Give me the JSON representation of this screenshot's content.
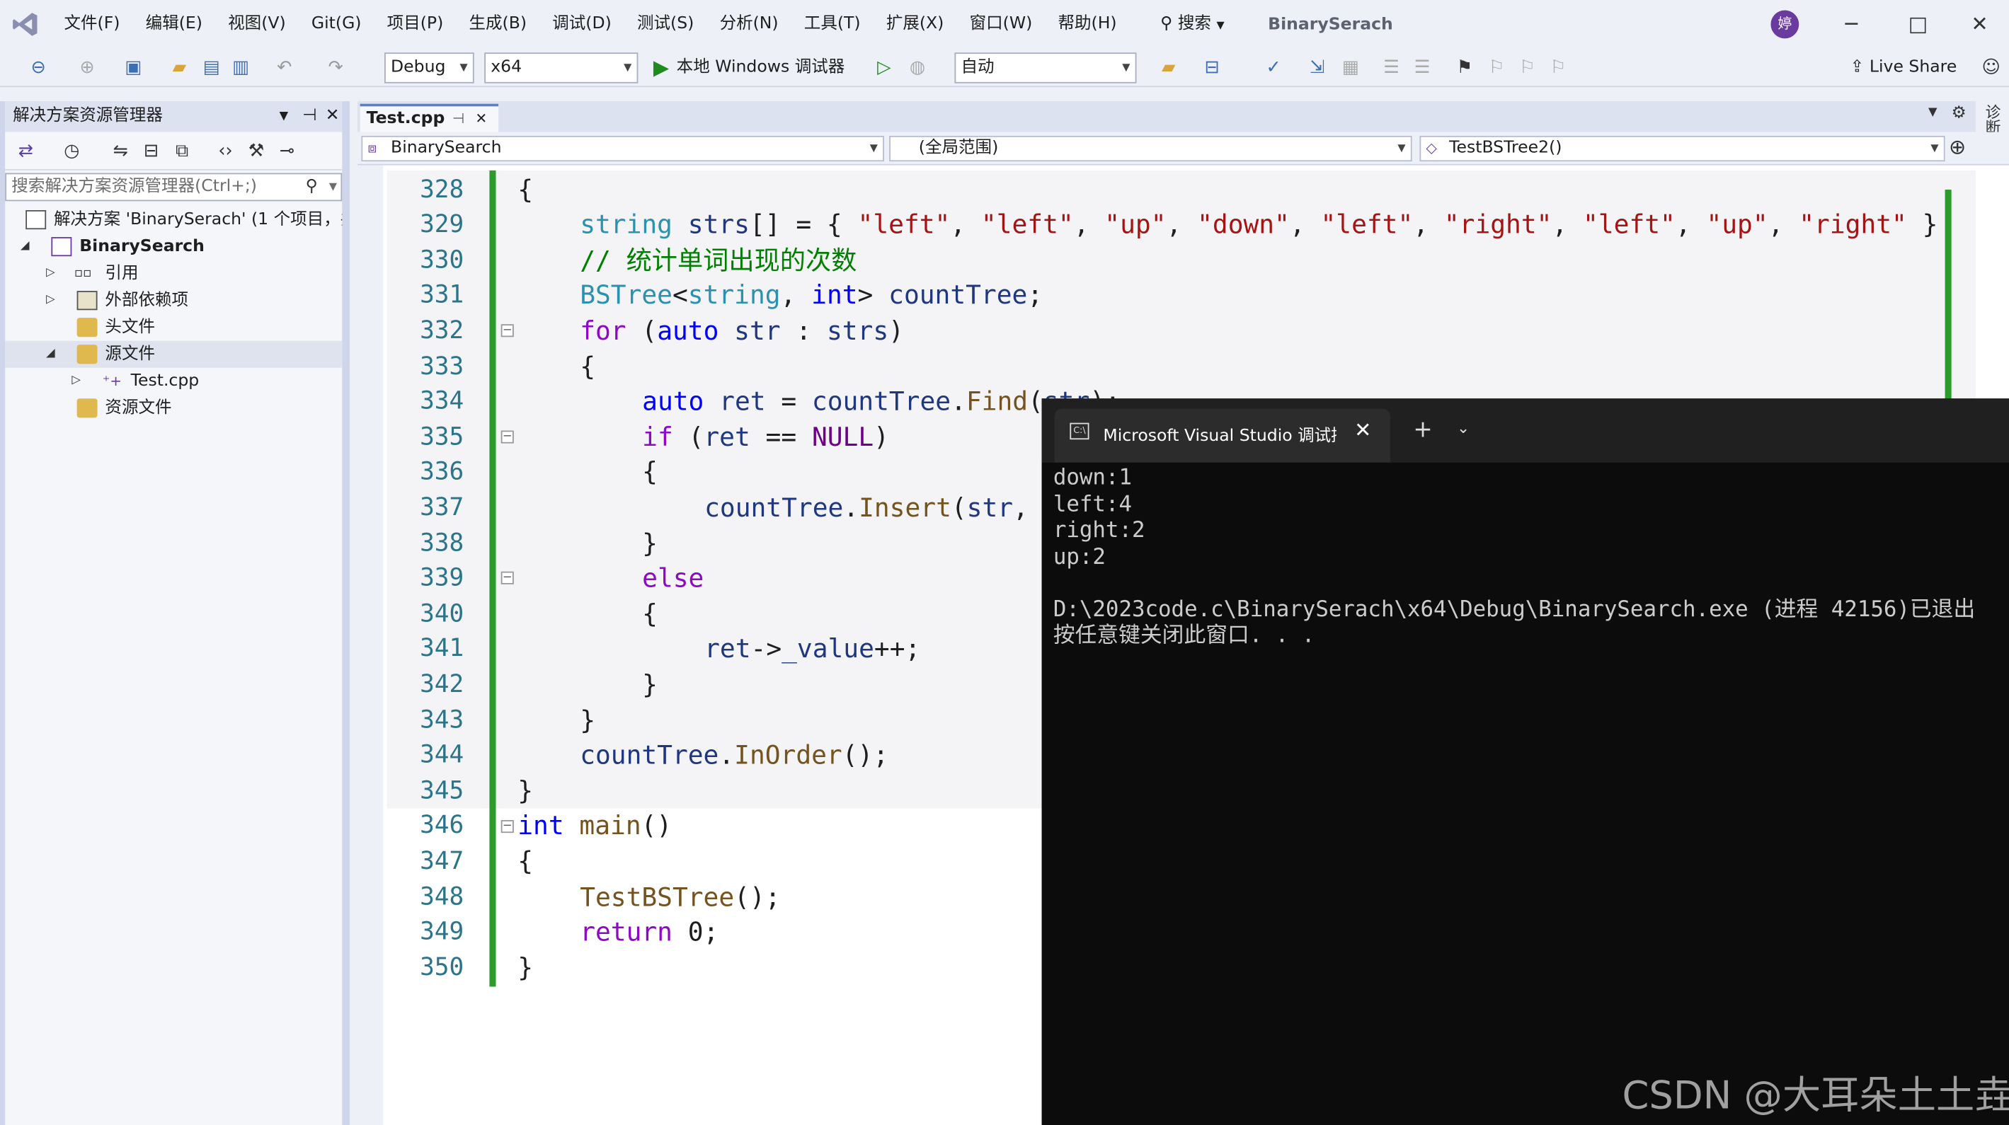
{
  "menubar": {
    "items": [
      "文件(F)",
      "编辑(E)",
      "视图(V)",
      "Git(G)",
      "项目(P)",
      "生成(B)",
      "调试(D)",
      "测试(S)",
      "分析(N)",
      "工具(T)",
      "扩展(X)",
      "窗口(W)",
      "帮助(H)"
    ],
    "search_label": "搜索",
    "solution_name": "BinarySerach",
    "avatar_text": "婷",
    "minimize": "─",
    "maximize": "□",
    "close": "✕"
  },
  "toolbar": {
    "config": "Debug",
    "platform": "x64",
    "run_label": "本地 Windows 调试器",
    "auto_combo": "自动",
    "live_share": "Live Share"
  },
  "solution_explorer": {
    "title": "解决方案资源管理器",
    "search_placeholder": "搜索解决方案资源管理器(Ctrl+;)",
    "solution_label": "解决方案 'BinarySerach' (1 个项目，共",
    "project": "BinarySearch",
    "items": [
      "引用",
      "外部依赖项",
      "头文件",
      "源文件",
      "Test.cpp",
      "资源文件"
    ]
  },
  "editor": {
    "tab_label": "Test.cpp",
    "tab_pin": "⊣",
    "tab_close": "✕",
    "nav_project": "BinarySearch",
    "nav_scope": "(全局范围)",
    "nav_function": "TestBSTree2()",
    "line_numbers": [
      "328",
      "329",
      "330",
      "331",
      "332",
      "333",
      "334",
      "335",
      "336",
      "337",
      "338",
      "339",
      "340",
      "341",
      "342",
      "343",
      "344",
      "345",
      "346",
      "347",
      "348",
      "349",
      "350"
    ]
  },
  "terminal": {
    "title": "Microsoft Visual Studio 调试控制台",
    "close": "✕",
    "new_tab": "+",
    "dropdown": "⌄",
    "lines": [
      "down:1",
      "left:4",
      "right:2",
      "up:2",
      "",
      "D:\\2023code.c\\BinarySerach\\x64\\Debug\\BinarySearch.exe (进程 42156)已退出",
      "按任意键关闭此窗口. . ."
    ]
  },
  "side_tool_label": "诊断工具",
  "watermark": "CSDN @大耳朵土土垚",
  "colors": {
    "accent": "#5a7fc7",
    "green_margin": "#2b9b2b",
    "terminal_bg": "#0c0c0c"
  }
}
